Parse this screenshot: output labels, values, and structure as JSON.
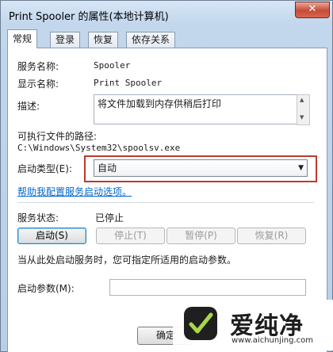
{
  "window": {
    "title": "Print Spooler 的属性(本地计算机)",
    "close_icon": "✕"
  },
  "tabs": [
    {
      "label": "常规",
      "active": true
    },
    {
      "label": "登录"
    },
    {
      "label": "恢复"
    },
    {
      "label": "依存关系"
    }
  ],
  "general": {
    "service_name_label": "服务名称:",
    "service_name_value": "Spooler",
    "display_name_label": "显示名称:",
    "display_name_value": "Print Spooler",
    "description_label": "描述:",
    "description_value": "将文件加载到内存供稍后打印",
    "exec_path_label": "可执行文件的路径:",
    "exec_path_value": "C:\\Windows\\System32\\spoolsv.exe",
    "startup_type_label": "启动类型(E):",
    "startup_type_value": "自动",
    "help_link": "帮助我配置服务启动选项。",
    "service_status_label": "服务状态:",
    "service_status_value": "已停止",
    "buttons": {
      "start": "启动(S)",
      "stop": "停止(T)",
      "pause": "暂停(P)",
      "resume": "恢复(R)"
    },
    "hint": "当从此处启动服务时，您可指定所适用的启动参数。",
    "start_params_label": "启动参数(M):",
    "start_params_value": ""
  },
  "footer": {
    "ok_button": "确定"
  },
  "watermark": {
    "text": "爱纯净",
    "url": "www.aichunjing.com"
  },
  "colors": {
    "highlight_frame": "#c0392b",
    "link": "#0066cc"
  }
}
